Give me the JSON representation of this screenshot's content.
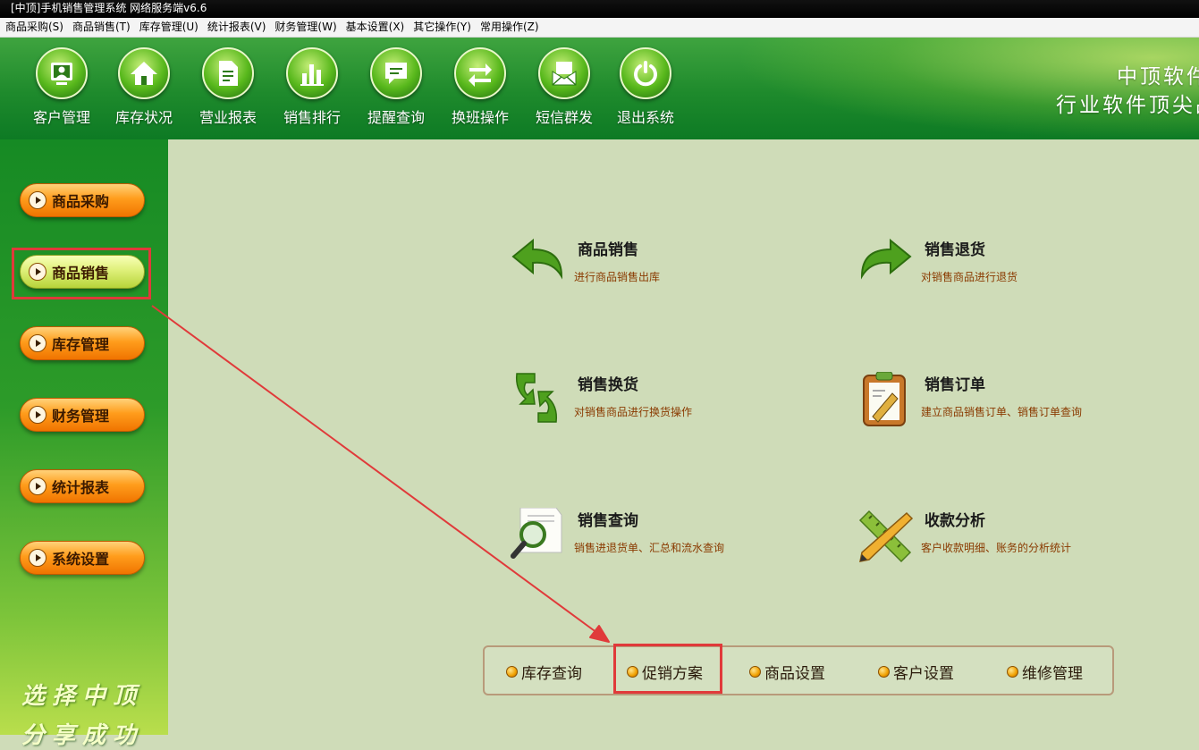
{
  "window": {
    "title": "[中顶]手机销售管理系统 网络服务端v6.6"
  },
  "menubar": {
    "items": [
      {
        "label": "商品采购(S)"
      },
      {
        "label": "商品销售(T)"
      },
      {
        "label": "库存管理(U)"
      },
      {
        "label": "统计报表(V)"
      },
      {
        "label": "财务管理(W)"
      },
      {
        "label": "基本设置(X)"
      },
      {
        "label": "其它操作(Y)"
      },
      {
        "label": "常用操作(Z)"
      }
    ]
  },
  "toolbar": {
    "buttons": [
      {
        "label": "客户管理",
        "icon": "customer-icon"
      },
      {
        "label": "库存状况",
        "icon": "home-icon"
      },
      {
        "label": "营业报表",
        "icon": "report-icon"
      },
      {
        "label": "销售排行",
        "icon": "bar-chart-icon"
      },
      {
        "label": "提醒查询",
        "icon": "message-icon"
      },
      {
        "label": "换班操作",
        "icon": "swap-icon"
      },
      {
        "label": "短信群发",
        "icon": "mail-icon"
      },
      {
        "label": "退出系统",
        "icon": "power-icon"
      }
    ],
    "brand_line1": "中顶软件",
    "brand_line2": "行业软件顶尖品牌"
  },
  "sidebar": {
    "items": [
      {
        "label": "商品采购",
        "active": false
      },
      {
        "label": "商品销售",
        "active": true
      },
      {
        "label": "库存管理",
        "active": false
      },
      {
        "label": "财务管理",
        "active": false
      },
      {
        "label": "统计报表",
        "active": false
      },
      {
        "label": "系统设置",
        "active": false
      }
    ],
    "slogan_line1": "选择中顶",
    "slogan_line2": "分享成功"
  },
  "main": {
    "features": [
      {
        "title": "商品销售",
        "desc": "进行商品销售出库",
        "icon": "undo-arrow-icon"
      },
      {
        "title": "销售退货",
        "desc": "对销售商品进行退货",
        "icon": "redo-arrow-icon"
      },
      {
        "title": "销售换货",
        "desc": "对销售商品进行换货操作",
        "icon": "recycle-icon"
      },
      {
        "title": "销售订单",
        "desc": "建立商品销售订单、销售订单查询",
        "icon": "clipboard-icon"
      },
      {
        "title": "销售查询",
        "desc": "销售进退货单、汇总和流水查询",
        "icon": "magnifier-icon"
      },
      {
        "title": "收款分析",
        "desc": "客户收款明细、账务的分析统计",
        "icon": "ruler-pencil-icon"
      }
    ]
  },
  "quickbar": {
    "items": [
      {
        "label": "库存查询"
      },
      {
        "label": "促销方案"
      },
      {
        "label": "商品设置"
      },
      {
        "label": "客户设置"
      },
      {
        "label": "维修管理"
      }
    ]
  },
  "colors": {
    "toolbar_green": "#1e8a2c",
    "panel_bg": "#cfdcb8",
    "sidebar_button_orange": "#ff9d1c",
    "sidebar_button_active": "#dff07a",
    "annotation_red": "#e03a3a",
    "desc_text": "#8a3a00"
  }
}
